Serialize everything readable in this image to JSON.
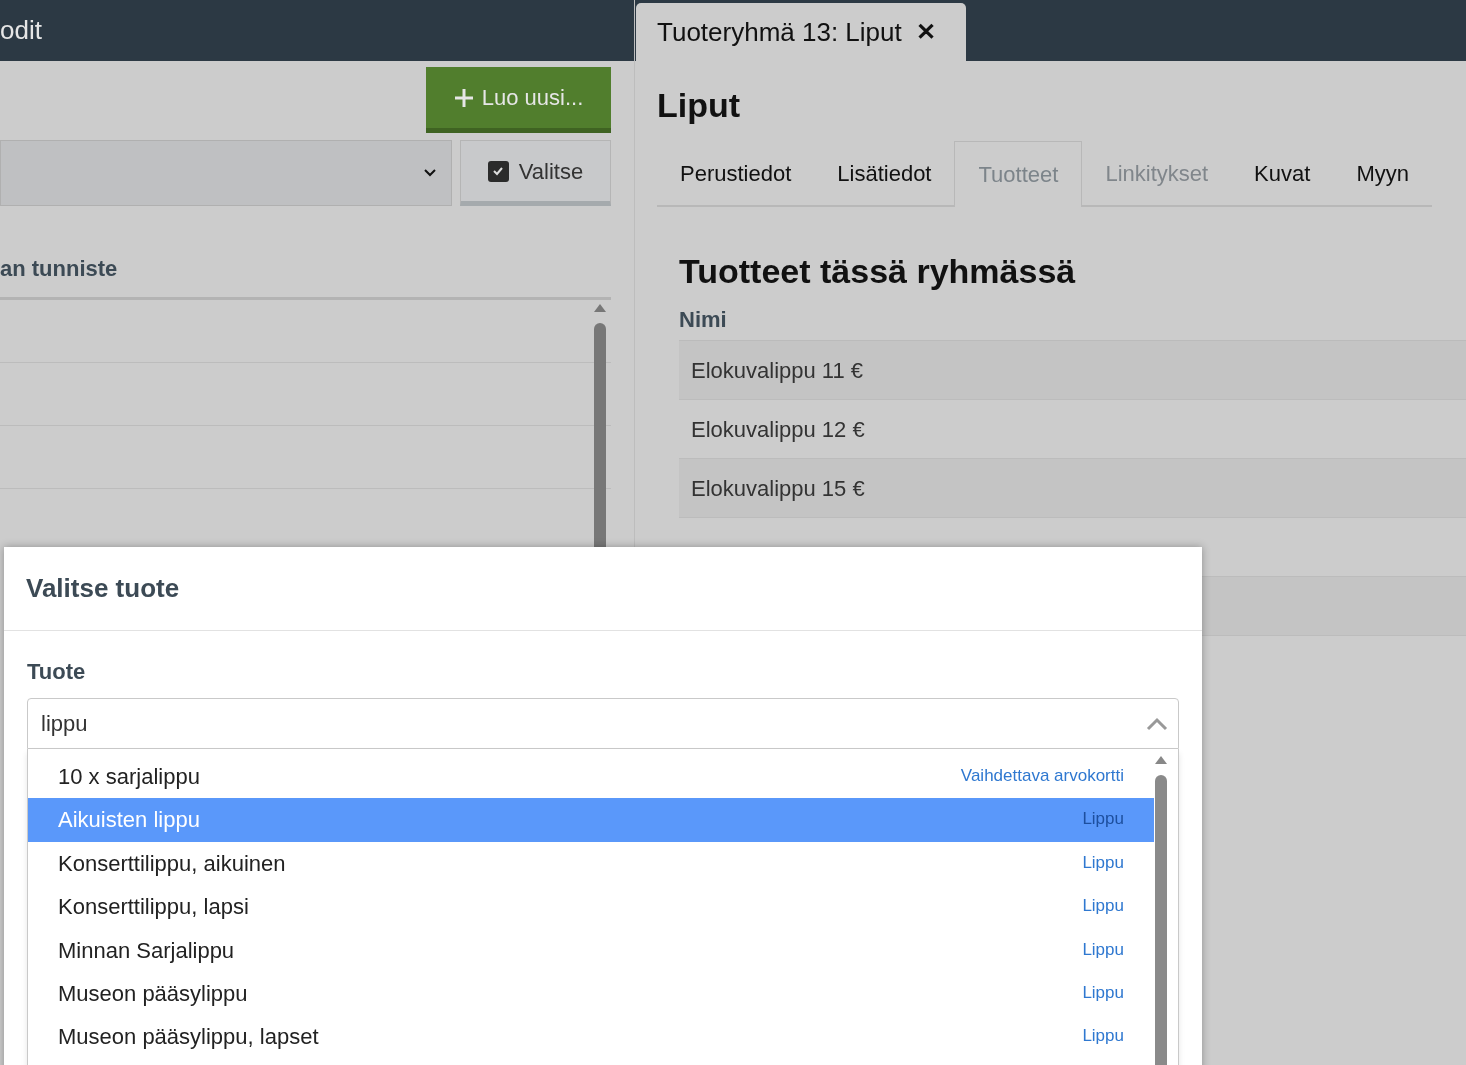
{
  "left_panel": {
    "title": "odit",
    "create_button": "Luo uusi...",
    "select_button": {
      "label": "Valitse",
      "checked": true
    },
    "column_heading": "an tunniste"
  },
  "right_panel": {
    "tab": {
      "label": "Tuoteryhmä 13: Liput",
      "close": "✕"
    },
    "heading": "Liput",
    "tabs": [
      {
        "label": "Perustiedot",
        "selected": false,
        "disabled": false
      },
      {
        "label": "Lisätiedot",
        "selected": false,
        "disabled": false
      },
      {
        "label": "Tuotteet",
        "selected": true,
        "disabled": false
      },
      {
        "label": "Linkitykset",
        "selected": false,
        "disabled": true
      },
      {
        "label": "Kuvat",
        "selected": false,
        "disabled": false
      },
      {
        "label": "Myyn",
        "selected": false,
        "disabled": false
      }
    ],
    "section_title": "Tuotteet tässä ryhmässä",
    "column": "Nimi",
    "rows": [
      "Elokuvalippu 11 €",
      "Elokuvalippu 12 €",
      "Elokuvalippu 15 €"
    ]
  },
  "dialog": {
    "title": "Valitse tuote",
    "field_label": "Tuote",
    "value": "lippu",
    "options": [
      {
        "name": "10 x sarjalippu",
        "category": "Vaihdettava arvokortti",
        "selected": false
      },
      {
        "name": "Aikuisten lippu",
        "category": "Lippu",
        "selected": true
      },
      {
        "name": "Konserttilippu, aikuinen",
        "category": "Lippu",
        "selected": false
      },
      {
        "name": "Konserttilippu, lapsi",
        "category": "Lippu",
        "selected": false
      },
      {
        "name": "Minnan Sarjalippu",
        "category": "Lippu",
        "selected": false
      },
      {
        "name": "Museon pääsylippu",
        "category": "Lippu",
        "selected": false
      },
      {
        "name": "Museon pääsylippu, lapset",
        "category": "Lippu",
        "selected": false
      }
    ]
  }
}
